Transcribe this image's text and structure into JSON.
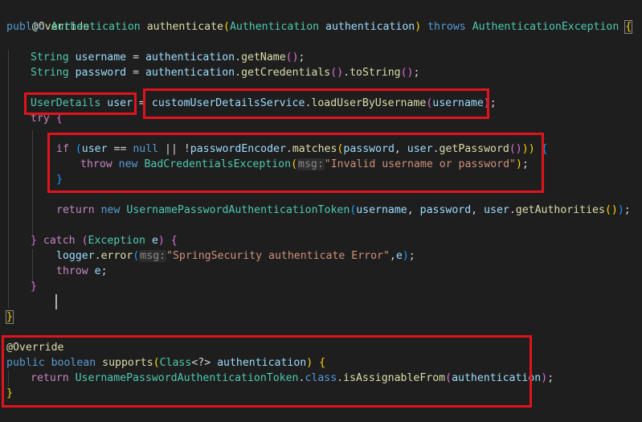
{
  "code": {
    "l1": {
      "annotation": "@Override"
    },
    "l2": {
      "t1": "public",
      "t2": "Authentication",
      "t3": "authenticate",
      "t4": "(",
      "t5": "Authentication",
      "t6": "authentication",
      "t7": ")",
      "t8": "throws",
      "t9": "AuthenticationException",
      "t10": "{"
    },
    "l4": {
      "t1": "String",
      "t2": "username",
      "t3": " = ",
      "t4": "authentication",
      "t5": ".",
      "t6": "getName",
      "t7": "()",
      "t8": ";"
    },
    "l5": {
      "t1": "String",
      "t2": "password",
      "t3": " = ",
      "t4": "authentication",
      "t5": ".",
      "t6": "getCredentials",
      "t7": "()",
      "t8": ".",
      "t9": "toString",
      "t10": "()",
      "t11": ";"
    },
    "l7": {
      "t1": "UserDetails",
      "t2": "user",
      "t3": " = ",
      "t4": "customUserDetailsService",
      "t5": ".",
      "t6": "loadUserByUsername",
      "t7": "(",
      "t8": "username",
      "t9": ")",
      "t10": ";"
    },
    "l8": {
      "t1": "try",
      "t2": "{"
    },
    "l10": {
      "t1": "if",
      "t2": "(",
      "t3": "user",
      "t4": " == ",
      "t5": "null",
      "t6": " || !",
      "t7": "passwordEncoder",
      "t8": ".",
      "t9": "matches",
      "t10": "(",
      "t11": "password",
      "t12": ", ",
      "t13": "user",
      "t14": ".",
      "t15": "getPassword",
      "t16": "()",
      "t17": "))",
      "t18": " {"
    },
    "l11": {
      "t1": "throw",
      "t2": "new",
      "t3": "BadCredentialsException",
      "t4": "(",
      "t5": "msg:",
      "t6": "\"Invalid username or password\"",
      "t7": ")",
      "t8": ";"
    },
    "l12": {
      "t1": "}"
    },
    "l14": {
      "t1": "return",
      "t2": "new",
      "t3": "UsernamePasswordAuthenticationToken",
      "t4": "(",
      "t5": "username",
      "t6": ", ",
      "t7": "password",
      "t8": ", ",
      "t9": "user",
      "t10": ".",
      "t11": "getAuthorities",
      "t12": "()",
      "t13": ")",
      "t14": ";"
    },
    "l16": {
      "t1": "}",
      "t2": "catch",
      "t3": "(",
      "t4": "Exception",
      "t5": "e",
      "t6": ")",
      "t7": "{"
    },
    "l17": {
      "t1": "logger",
      "t2": ".",
      "t3": "error",
      "t4": "(",
      "t5": "msg:",
      "t6": "\"SpringSecurity authenticate Error\"",
      "t7": ",",
      "t8": "e",
      "t9": ")",
      "t10": ";"
    },
    "l18": {
      "t1": "throw",
      "t2": "e",
      "t3": ";"
    },
    "l19": {
      "t1": "}"
    },
    "l21": {
      "t1": "}"
    },
    "l23": {
      "annotation": "@Override"
    },
    "l24": {
      "t1": "public",
      "t2": "boolean",
      "t3": "supports",
      "t4": "(",
      "t5": "Class",
      "t6": "<?>",
      "t7": "authentication",
      "t8": ")",
      "t9": " {"
    },
    "l25": {
      "t1": "return",
      "t2": "UsernamePasswordAuthenticationToken",
      "t3": ".",
      "t4": "class",
      "t5": ".",
      "t6": "isAssignableFrom",
      "t7": "(",
      "t8": "authentication",
      "t9": ")",
      "t10": ";"
    },
    "l26": {
      "t1": "}"
    }
  },
  "colors": {
    "highlight_box": "#e0141e",
    "background": "#1e1e1e"
  }
}
